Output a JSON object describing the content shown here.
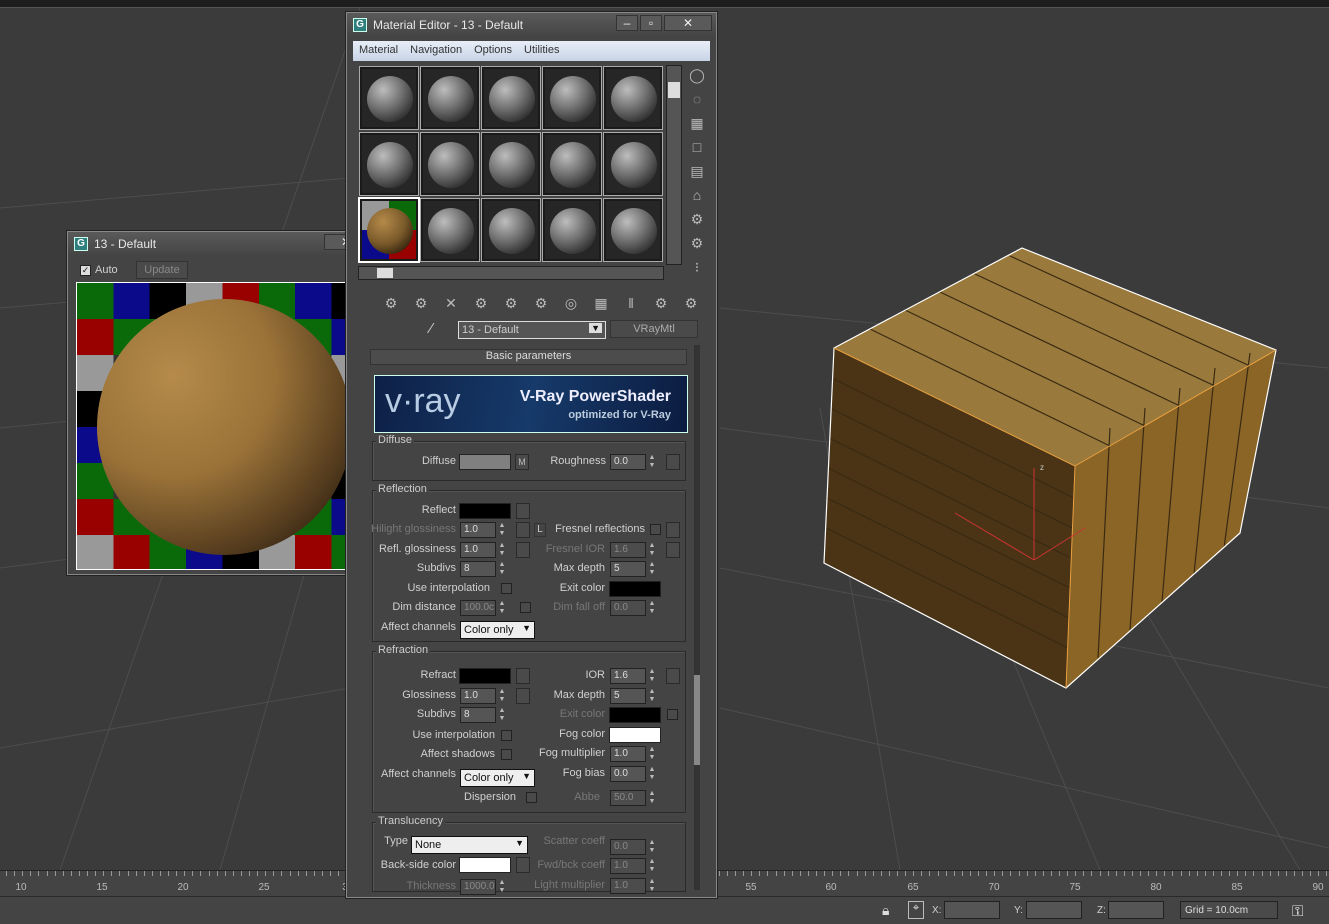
{
  "viewport": {
    "axis_label": "z"
  },
  "timeline": {
    "ticks": [
      "10",
      "15",
      "20",
      "25",
      "3",
      "55",
      "60",
      "65",
      "70",
      "75",
      "80",
      "85",
      "90"
    ]
  },
  "status": {
    "x_label": "X:",
    "y_label": "Y:",
    "z_label": "Z:",
    "grid": "Grid = 10.0cm",
    "icons": [
      "lock-icon",
      "absolute-mode-icon",
      "key-icon"
    ]
  },
  "preview": {
    "title": "13 - Default",
    "auto_label": "Auto",
    "auto_checked": true,
    "update_label": "Update"
  },
  "editor": {
    "title": "Material Editor - 13 - Default",
    "menu": [
      "Material",
      "Navigation",
      "Options",
      "Utilities"
    ],
    "material_name": "13 - Default",
    "material_type": "VRayMtl",
    "rollout_title": "Basic parameters",
    "banner": {
      "logo": "v·ray",
      "title": "V-Ray PowerShader",
      "subtitle": "optimized for V-Ray"
    },
    "diffuse": {
      "group": "Diffuse",
      "diffuse_label": "Diffuse",
      "map_btn": "M",
      "roughness_label": "Roughness",
      "roughness": "0.0"
    },
    "reflection": {
      "group": "Reflection",
      "reflect_label": "Reflect",
      "hilight_label": "Hilight glossiness",
      "hilight": "1.0",
      "lock": "L",
      "fresnel_label": "Fresnel reflections",
      "refl_gloss_label": "Refl. glossiness",
      "refl_gloss": "1.0",
      "fresnel_ior_label": "Fresnel IOR",
      "fresnel_ior": "1.6",
      "subdivs_label": "Subdivs",
      "subdivs": "8",
      "max_depth_label": "Max depth",
      "max_depth": "5",
      "use_interp_label": "Use interpolation",
      "exit_color_label": "Exit color",
      "dim_dist_label": "Dim distance",
      "dim_dist": "100.0c",
      "dim_falloff_label": "Dim fall off",
      "dim_falloff": "0.0",
      "affect_label": "Affect channels",
      "affect": "Color only"
    },
    "refraction": {
      "group": "Refraction",
      "refract_label": "Refract",
      "ior_label": "IOR",
      "ior": "1.6",
      "gloss_label": "Glossiness",
      "gloss": "1.0",
      "max_depth_label": "Max depth",
      "max_depth": "5",
      "subdivs_label": "Subdivs",
      "subdivs": "8",
      "exit_color_label": "Exit color",
      "use_interp_label": "Use interpolation",
      "fog_color_label": "Fog color",
      "affect_shadows_label": "Affect shadows",
      "fog_mult_label": "Fog multiplier",
      "fog_mult": "1.0",
      "affect_label": "Affect channels",
      "affect": "Color only",
      "fog_bias_label": "Fog bias",
      "fog_bias": "0.0",
      "dispersion_label": "Dispersion",
      "abbe_label": "Abbe",
      "abbe": "50.0"
    },
    "translucency": {
      "group": "Translucency",
      "type_label": "Type",
      "type": "None",
      "scatter_label": "Scatter coeff",
      "scatter": "0.0",
      "backside_label": "Back-side color",
      "fwd_label": "Fwd/bck coeff",
      "fwd": "1.0",
      "thickness_label": "Thickness",
      "thickness": "1000.0",
      "light_mult_label": "Light multiplier",
      "light_mult": "1.0"
    }
  },
  "colors": {
    "reflect": "#000000",
    "exit": "#000000",
    "fog": "#ffffff",
    "backside": "#ffffff",
    "diffuse": "#808080"
  }
}
